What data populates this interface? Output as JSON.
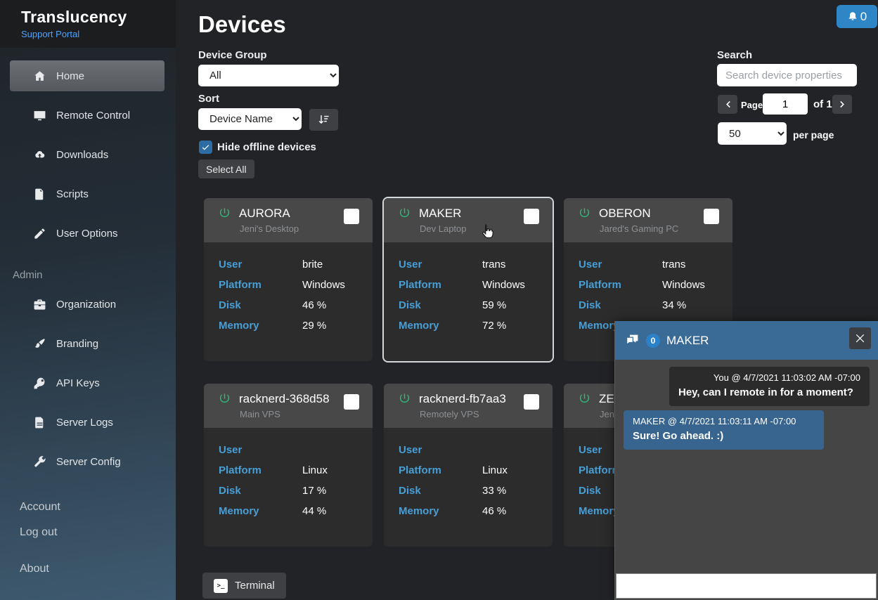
{
  "brand": {
    "title": "Translucency",
    "subtitle": "Support Portal"
  },
  "sidebar": {
    "items": [
      {
        "label": "Home",
        "icon": "home-icon",
        "active": true
      },
      {
        "label": "Remote Control",
        "icon": "monitor-icon"
      },
      {
        "label": "Downloads",
        "icon": "download-icon"
      },
      {
        "label": "Scripts",
        "icon": "scripts-icon"
      },
      {
        "label": "User Options",
        "icon": "pencil-icon"
      }
    ],
    "admin_label": "Admin",
    "admin_items": [
      {
        "label": "Organization",
        "icon": "briefcase-icon"
      },
      {
        "label": "Branding",
        "icon": "brush-icon"
      },
      {
        "label": "API Keys",
        "icon": "key-icon"
      },
      {
        "label": "Server Logs",
        "icon": "logs-icon"
      },
      {
        "label": "Server Config",
        "icon": "wrench-icon"
      }
    ],
    "footer_items": [
      "Account",
      "Log out",
      "About"
    ]
  },
  "header": {
    "title": "Devices",
    "notification_count": "0"
  },
  "filters": {
    "device_group_label": "Device Group",
    "device_group_value": "All",
    "sort_label": "Sort",
    "sort_value": "Device Name",
    "hide_offline_label": "Hide offline devices",
    "hide_offline_checked": true,
    "select_all_label": "Select All"
  },
  "search": {
    "label": "Search",
    "placeholder": "Search device properties",
    "page_label": "Page",
    "page_value": "1",
    "page_total": "of 1",
    "per_page_value": "50",
    "per_page_label": "per page"
  },
  "field_labels": {
    "user": "User",
    "platform": "Platform",
    "disk": "Disk",
    "memory": "Memory"
  },
  "devices": [
    {
      "name": "AURORA",
      "subtitle": "Jeni's Desktop",
      "user": "brite",
      "platform": "Windows",
      "disk": "46 %",
      "memory": "29 %"
    },
    {
      "name": "MAKER",
      "subtitle": "Dev Laptop",
      "user": "trans",
      "platform": "Windows",
      "disk": "59 %",
      "memory": "72 %",
      "hover": true
    },
    {
      "name": "OBERON",
      "subtitle": "Jared's Gaming PC",
      "user": "trans",
      "platform": "Windows",
      "disk": "34 %",
      "memory": ""
    },
    {
      "name": "racknerd-368d58",
      "subtitle": "Main VPS",
      "user": "",
      "platform": "Linux",
      "disk": "17 %",
      "memory": "44 %"
    },
    {
      "name": "racknerd-fb7aa3",
      "subtitle": "Remotely VPS",
      "user": "",
      "platform": "Linux",
      "disk": "33 %",
      "memory": "46 %"
    },
    {
      "name": "ZEN",
      "subtitle": "Jeni's",
      "user": "",
      "platform": "",
      "disk": "",
      "memory": ""
    }
  ],
  "terminal": {
    "label": "Terminal",
    "icon_glyph": ">_"
  },
  "chat": {
    "title": "MAKER",
    "badge": "0",
    "messages": [
      {
        "side": "right",
        "meta": "You  @  4/7/2021 11:03:02 AM -07:00",
        "text": "Hey, can I remote in for a moment?"
      },
      {
        "side": "left",
        "meta": "MAKER  @  4/7/2021 11:03:11 AM -07:00",
        "text": "Sure! Go ahead. :)"
      }
    ]
  },
  "colors": {
    "accent_blue": "#2f86c7",
    "label_blue": "#479fd8",
    "chat_header": "#3a6a96",
    "power_green": "#2eb877",
    "link_blue": "#4da3ff"
  }
}
